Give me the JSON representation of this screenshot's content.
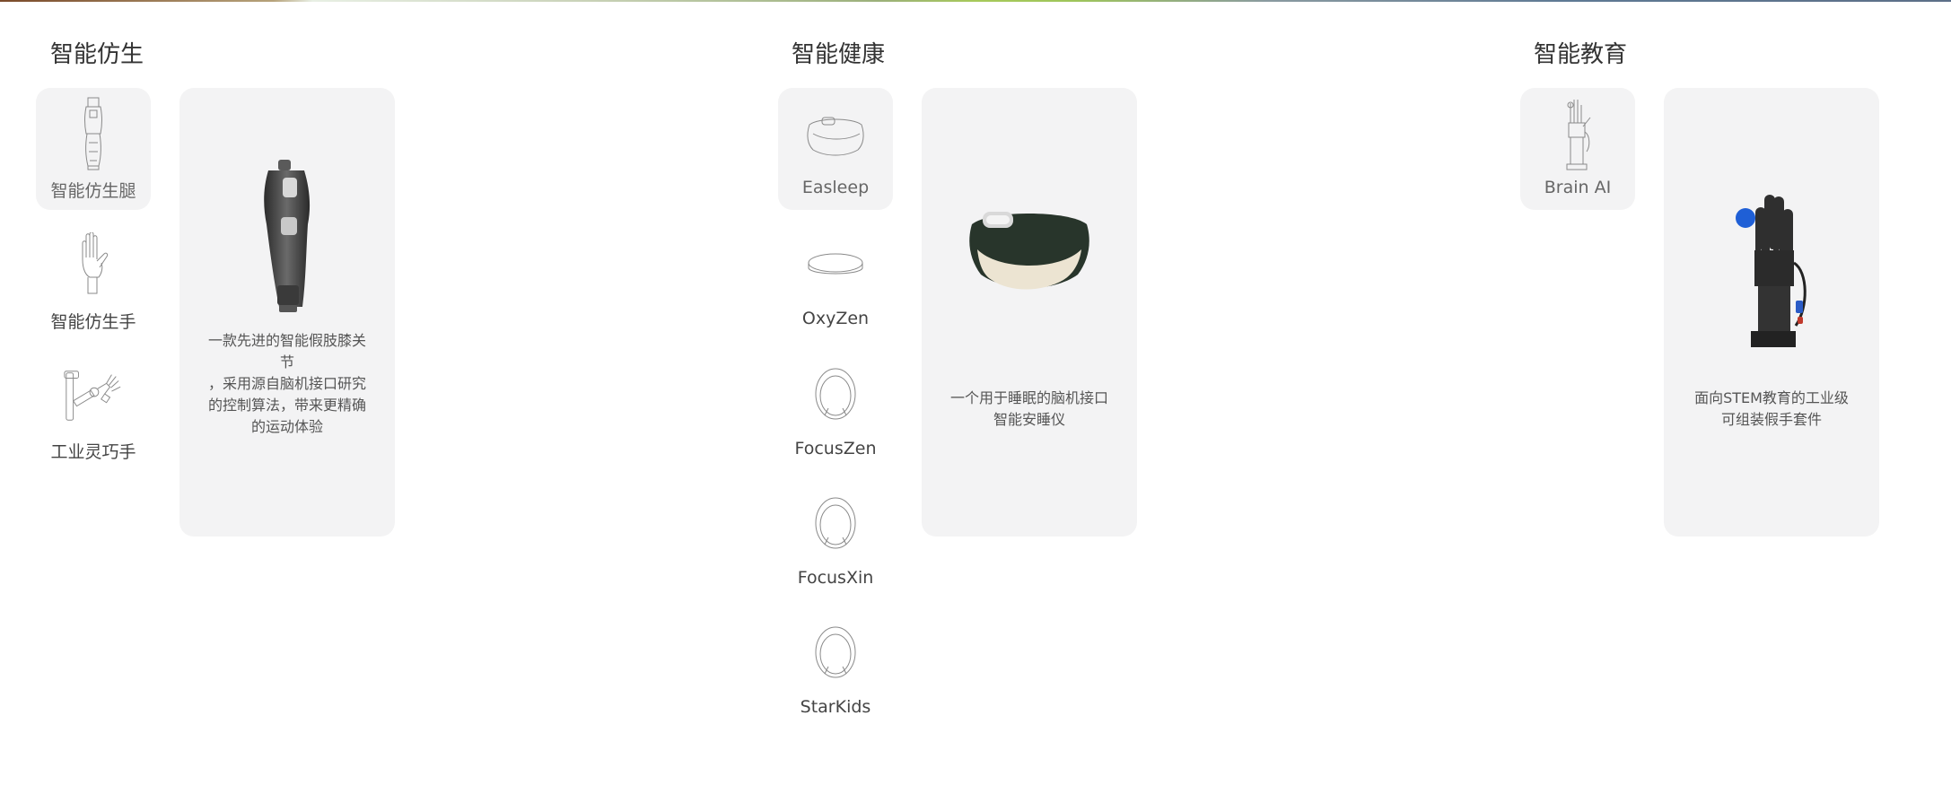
{
  "sections": [
    {
      "title": "智能仿生",
      "items": [
        {
          "label": "智能仿生腿",
          "icon": "bionic-leg-icon",
          "active": true
        },
        {
          "label": "智能仿生手",
          "icon": "bionic-hand-icon",
          "active": false
        },
        {
          "label": "工业灵巧手",
          "icon": "dexterous-hand-icon",
          "active": false
        }
      ],
      "card": {
        "image": "bionic-knee-prosthesis",
        "description": "一款先进的智能假肢膝关节\n，采用源自脑机接口研究的控制算法，带来更精确的运动体验"
      }
    },
    {
      "title": "智能健康",
      "items": [
        {
          "label": "Easleep",
          "icon": "sleep-headband-icon",
          "active": true
        },
        {
          "label": "OxyZen",
          "icon": "headband-icon",
          "active": false
        },
        {
          "label": "FocusZen",
          "icon": "neckband-icon",
          "active": false
        },
        {
          "label": "FocusXin",
          "icon": "neckband-icon",
          "active": false
        },
        {
          "label": "StarKids",
          "icon": "neckband-icon",
          "active": false
        }
      ],
      "card": {
        "image": "sleep-headband",
        "description": "一个用于睡眠的脑机接口\n智能安睡仪"
      }
    },
    {
      "title": "智能教育",
      "items": [
        {
          "label": "Brain AI",
          "icon": "robotic-hand-icon",
          "active": true
        }
      ],
      "card": {
        "image": "robotic-hand-kit",
        "description": "面向STEM教育的工业级\n可组装假手套件"
      }
    }
  ],
  "colors": {
    "card_bg": "#f3f3f4",
    "headband_dark": "#28352b",
    "headband_cream": "#ece4d2",
    "ball_blue": "#1f5fd6"
  }
}
